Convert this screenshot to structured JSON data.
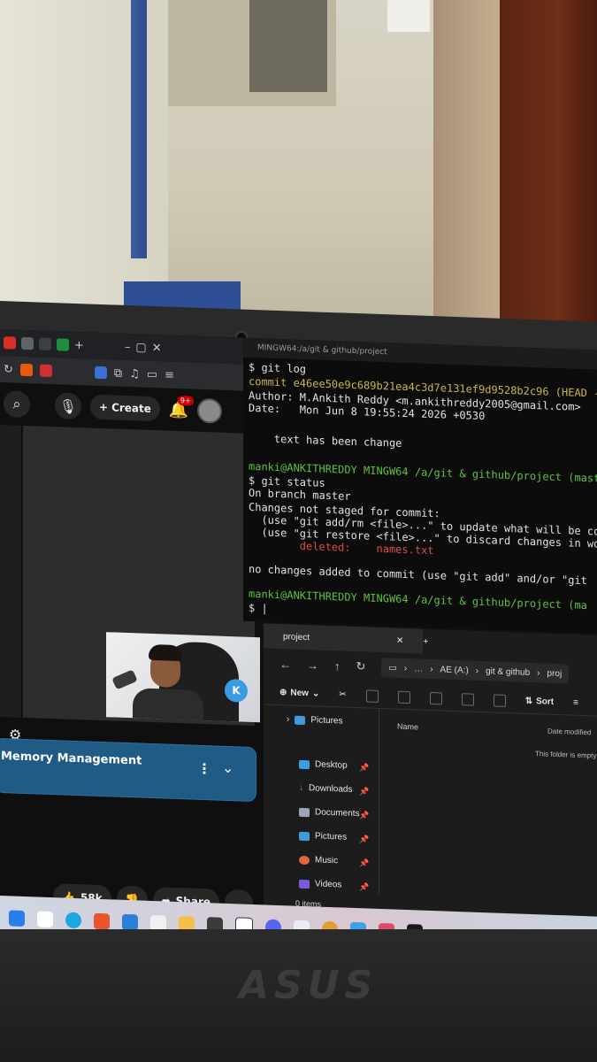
{
  "browser": {
    "create_label": "Create",
    "notif_count": "9+",
    "playlist_title": "Memory Management",
    "likes": "58k",
    "share_label": "Share"
  },
  "terminal": {
    "title": "MINGW64:/a/git & github/project",
    "lines": [
      "$ git log",
      "commit e46ee50e9c689b21ea4c3d7e131ef9d9528b2c96 (HEAD -> ma",
      "Author: M.Ankith Reddy <m.ankithreddy2005@gmail.com>",
      "Date:   Mon Jun 8 19:55:24 2026 +0530",
      "",
      "    text has been change",
      "",
      "manki@ANKITHREDDY MINGW64 /a/git & github/project (master",
      "$ git status",
      "On branch master",
      "Changes not staged for commit:",
      "  (use \"git add/rm <file>...\" to update what will be co",
      "  (use \"git restore <file>...\" to discard changes in wo",
      "        deleted:    names.txt",
      "",
      "no changes added to commit (use \"git add\" and/or \"git",
      "",
      "manki@ANKITHREDDY MINGW64 /a/git & github/project (ma",
      "$ |"
    ]
  },
  "explorer": {
    "tab_title": "project",
    "path": [
      "AE (A:)",
      "git & github",
      "proj"
    ],
    "new_label": "New",
    "sort_label": "Sort",
    "col_name": "Name",
    "col_date": "Date modified",
    "empty_text": "This folder is empty",
    "tree_top": "Pictures",
    "quick_access": [
      "Desktop",
      "Downloads",
      "Documents",
      "Pictures",
      "Music",
      "Videos"
    ],
    "status": "0 items"
  },
  "laptop": {
    "brand": "ASUS"
  }
}
